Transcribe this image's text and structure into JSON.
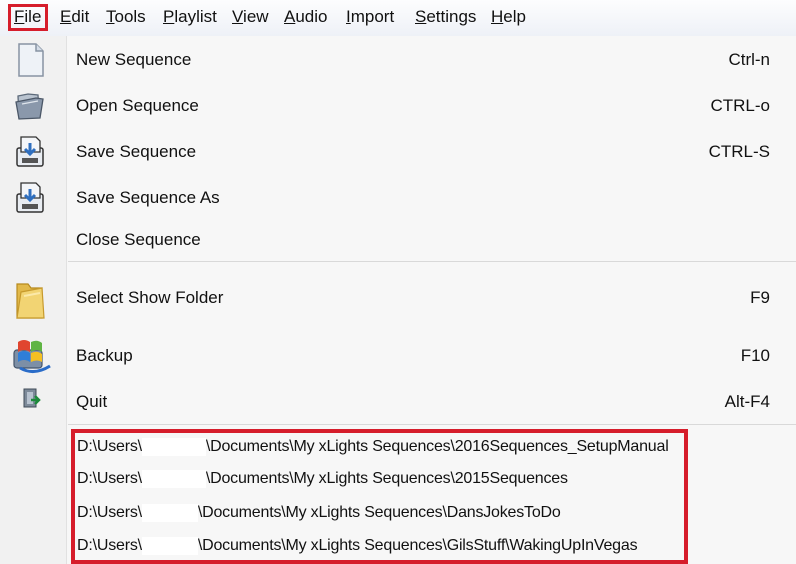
{
  "menubar": {
    "items": [
      {
        "key": "file",
        "underline": "F",
        "rest": "ile"
      },
      {
        "key": "edit",
        "underline": "E",
        "rest": "dit"
      },
      {
        "key": "tools",
        "underline": "T",
        "rest": "ools"
      },
      {
        "key": "playlist",
        "underline": "P",
        "rest": "laylist"
      },
      {
        "key": "view",
        "underline": "V",
        "rest": "iew"
      },
      {
        "key": "audio",
        "underline": "A",
        "rest": "udio"
      },
      {
        "key": "import",
        "underline": "I",
        "rest": "mport"
      },
      {
        "key": "settings",
        "underline": "S",
        "rest": "ettings"
      },
      {
        "key": "help",
        "underline": "H",
        "rest": "elp"
      }
    ]
  },
  "file_menu": {
    "items": [
      {
        "label": "New Sequence",
        "shortcut": "Ctrl-n",
        "icon": "new-document-icon"
      },
      {
        "label": "Open Sequence",
        "shortcut": "CTRL-o",
        "icon": "open-folder-icon"
      },
      {
        "label": "Save Sequence",
        "shortcut": "CTRL-S",
        "icon": "save-icon"
      },
      {
        "label": "Save Sequence As",
        "shortcut": "",
        "icon": "save-as-icon"
      },
      {
        "label": "Close Sequence",
        "shortcut": "",
        "icon": ""
      },
      {
        "label": "Select Show Folder",
        "shortcut": "F9",
        "icon": "folder-icon"
      },
      {
        "label": "Backup",
        "shortcut": "F10",
        "icon": "backup-icon"
      },
      {
        "label": "Quit",
        "shortcut": "Alt-F4",
        "icon": "exit-icon"
      }
    ],
    "recent": [
      {
        "prefix": "D:\\Users\\",
        "suffix": "\\Documents\\My xLights Sequences\\2016Sequences_SetupManual"
      },
      {
        "prefix": "D:\\Users\\",
        "suffix": "\\Documents\\My xLights Sequences\\2015Sequences"
      },
      {
        "prefix": "D:\\Users\\",
        "suffix": "\\Documents\\My xLights Sequences\\DansJokesToDo"
      },
      {
        "prefix": "D:\\Users\\",
        "suffix": "\\Documents\\My xLights Sequences\\GilsStuff\\WakingUpInVegas"
      }
    ]
  },
  "colors": {
    "highlight_border": "#d61d2b"
  }
}
